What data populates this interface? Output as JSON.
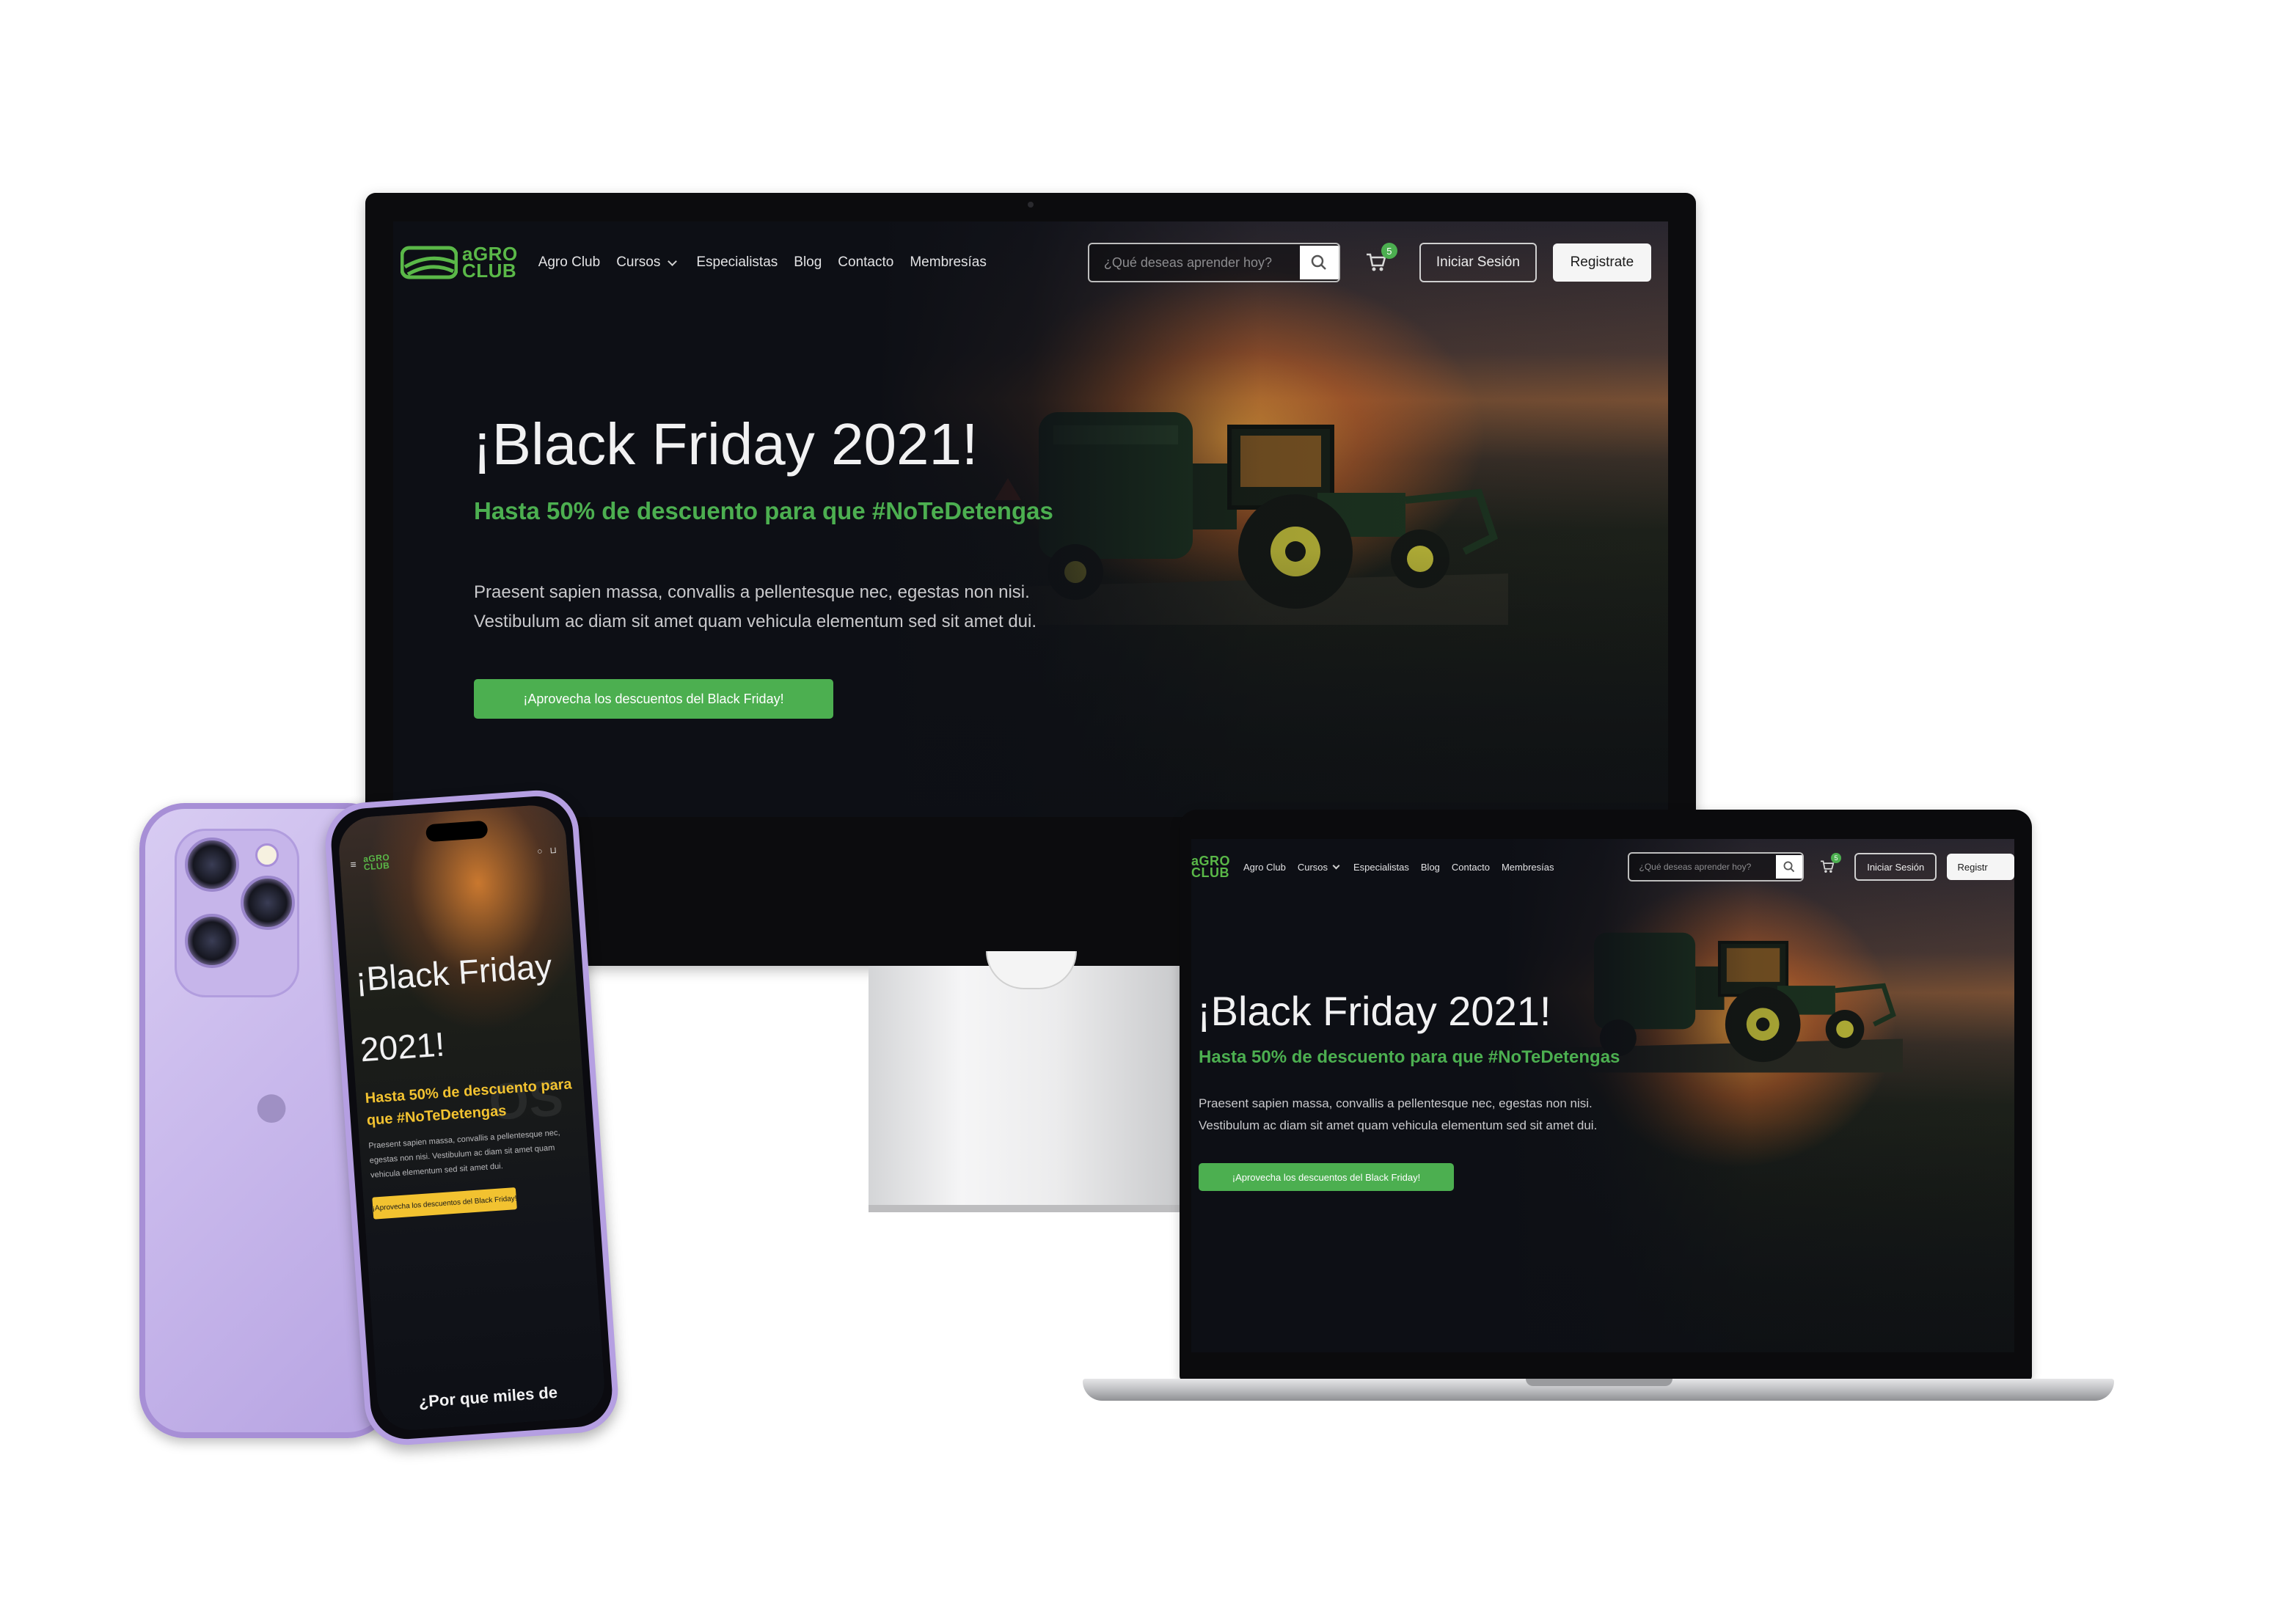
{
  "site": {
    "brand_top": "aGRO",
    "brand_bottom": "CLUB",
    "nav": [
      "Agro Club",
      "Cursos",
      "Especialistas",
      "Blog",
      "Contacto",
      "Membresías"
    ],
    "search_placeholder": "¿Qué deseas aprender hoy?",
    "cart_count": "5",
    "login_label": "Iniciar Sesión",
    "register_label": "Registrate",
    "register_label_truncated": "Registr"
  },
  "hero": {
    "title": "¡Black Friday 2021!",
    "subtitle": "Hasta 50% de descuento para que #NoTeDetengas",
    "body_line1": "Praesent sapien massa, convallis a pellentesque nec, egestas non nisi.",
    "body_line2": "Vestibulum ac diam sit amet quam vehicula elementum sed sit amet dui.",
    "cta": "¡Aprovecha los descuentos del Black Friday!"
  },
  "mobile": {
    "title_line1": "¡Black Friday",
    "title_line2": "2021!",
    "subtitle_line1": "Hasta 50% de descuento para",
    "subtitle_line2": "que #NoTeDetengas",
    "body_line1": "Praesent sapien massa, convallis a pellentesque nec,",
    "body_line2": "egestas non nisi. Vestibulum ac diam sit amet quam",
    "body_line3": "vehicula elementum sed sit amet dui.",
    "cta": "¡Aprovecha los descuentos del Black Friday!",
    "section_heading": "¿Por que miles de",
    "bg_word": "OS"
  },
  "colors": {
    "accent_green": "#4caf50",
    "mobile_accent": "#f2c230",
    "phone_purple": "#c9b9ec"
  }
}
